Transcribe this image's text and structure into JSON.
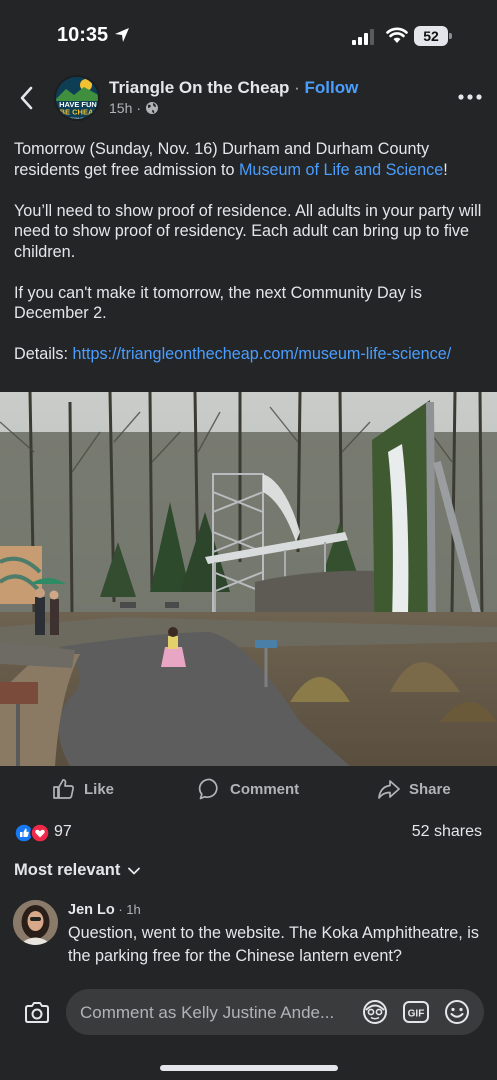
{
  "status_bar": {
    "time": "10:35",
    "battery": "52"
  },
  "header": {
    "page_name": "Triangle On the Cheap",
    "separator": " · ",
    "follow_label": "Follow",
    "age": "15h",
    "meta_sep": "·",
    "avatar_text_line1": "HAVE FUN.",
    "avatar_text_line2": "BE CHEAP",
    "avatar_text_line3": "TRIANGLE"
  },
  "post": {
    "p1_before": "Tomorrow (Sunday, Nov. 16) Durham and Durham County residents get free admission to ",
    "p1_link": "Museum of Life and Science",
    "p1_after": "!",
    "p2": "You’ll need to show proof of residence. All adults in your party will need to show proof of residency. Each adult can bring up to five children.",
    "p3": "If you can't make it tomorrow, the next Community Day is December 2.",
    "p4_label": "Details: ",
    "p4_link": "https://triangleonthecheap.com/museum-life-science/"
  },
  "actions": {
    "like": "Like",
    "comment": "Comment",
    "share": "Share"
  },
  "reactions": {
    "count": "97",
    "shares": "52 shares"
  },
  "comments_filter": "Most relevant",
  "comment": {
    "author": "Jen Lo",
    "time": " · 1h",
    "text": "Question, went to the website. The Koka Amphitheatre, is the parking free for the Chinese lantern event?"
  },
  "composer": {
    "placeholder": "Comment as Kelly Justine Ande...",
    "gif_label": "GIF"
  },
  "colors": {
    "background": "#242526",
    "link": "#4a9eff",
    "text": "#e4e6eb",
    "muted": "#b0b3b8",
    "like_blue": "#1877f2",
    "love_red": "#f0284a"
  }
}
